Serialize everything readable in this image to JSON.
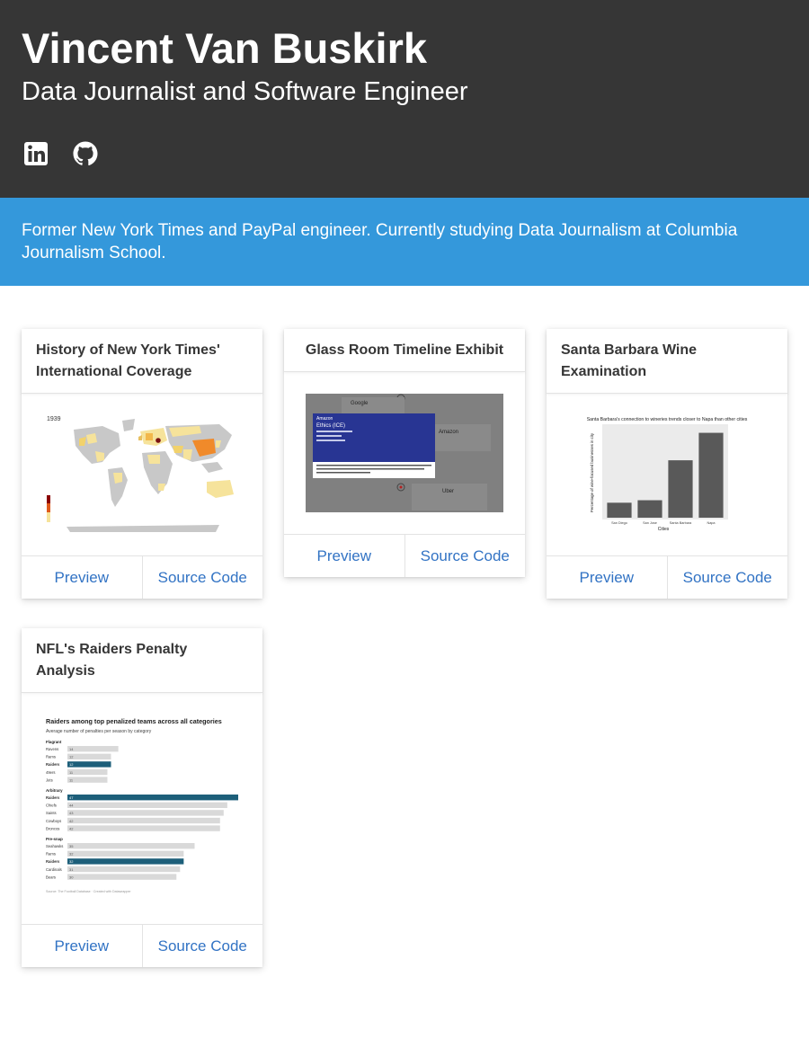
{
  "header": {
    "name": "Vincent Van Buskirk",
    "subtitle": "Data Journalist and Software Engineer",
    "social": [
      {
        "icon": "linkedin-icon"
      },
      {
        "icon": "github-icon"
      }
    ]
  },
  "banner": {
    "text": "Former New York Times and PayPal engineer. Currently studying Data Journalism at Columbia Journalism School."
  },
  "projects": [
    {
      "title": "History of New York Times' International Coverage",
      "preview_label": "Preview",
      "source_label": "Source Code",
      "thumbnail": {
        "year": "1939"
      }
    },
    {
      "title": "Glass Room Timeline Exhibit",
      "preview_label": "Preview",
      "source_label": "Source Code",
      "thumbnail": {
        "card1_company": "Google",
        "card2_company": "Amazon",
        "card2_subtitle": "Ethics (ICE)",
        "card3_company": "Amazon",
        "card4_company": "Uber"
      }
    },
    {
      "title": "Santa Barbara Wine Examination",
      "preview_label": "Preview",
      "source_label": "Source Code",
      "thumbnail": {
        "chart_title": "Santa Barbara's connection to wineries trends closer to Napa than other cities",
        "x_label": "Cities",
        "y_label": "Percentage of wine-focused businesses in city",
        "categories": [
          "San Diego",
          "San Jose",
          "Santa Barbara",
          "Napa"
        ],
        "values": [
          12,
          14,
          46,
          68
        ]
      }
    },
    {
      "title": "NFL's Raiders Penalty Analysis",
      "preview_label": "Preview",
      "source_label": "Source Code",
      "thumbnail": {
        "chart_title": "Raiders among top penalized teams across all categories",
        "chart_subtitle": "Average number of penalties per season by category",
        "source": "Source: The Football Database · Created with Datawrapper",
        "groups": [
          {
            "label": "Flagrant",
            "rows": [
              {
                "team": "Ravens",
                "value": 14
              },
              {
                "team": "Rams",
                "value": 12
              },
              {
                "team": "Raiders",
                "value": 12,
                "highlight": true
              },
              {
                "team": "49ers",
                "value": 11
              },
              {
                "team": "Jets",
                "value": 11
              }
            ]
          },
          {
            "label": "Arbitrary",
            "rows": [
              {
                "team": "Raiders",
                "value": 47,
                "highlight": true
              },
              {
                "team": "Chiefs",
                "value": 44
              },
              {
                "team": "Saints",
                "value": 43
              },
              {
                "team": "Cowboys",
                "value": 42
              },
              {
                "team": "Broncos",
                "value": 42
              }
            ]
          },
          {
            "label": "Pre-snap",
            "rows": [
              {
                "team": "Seahawks",
                "value": 35
              },
              {
                "team": "Rams",
                "value": 32
              },
              {
                "team": "Raiders",
                "value": 32,
                "highlight": true
              },
              {
                "team": "Cardinals",
                "value": 31
              },
              {
                "team": "Bears",
                "value": 30
              }
            ]
          }
        ]
      }
    }
  ],
  "colors": {
    "header_bg": "#363636",
    "banner_bg": "#3498db",
    "link": "#3273c4",
    "raiders_highlight": "#1d5f7a"
  }
}
